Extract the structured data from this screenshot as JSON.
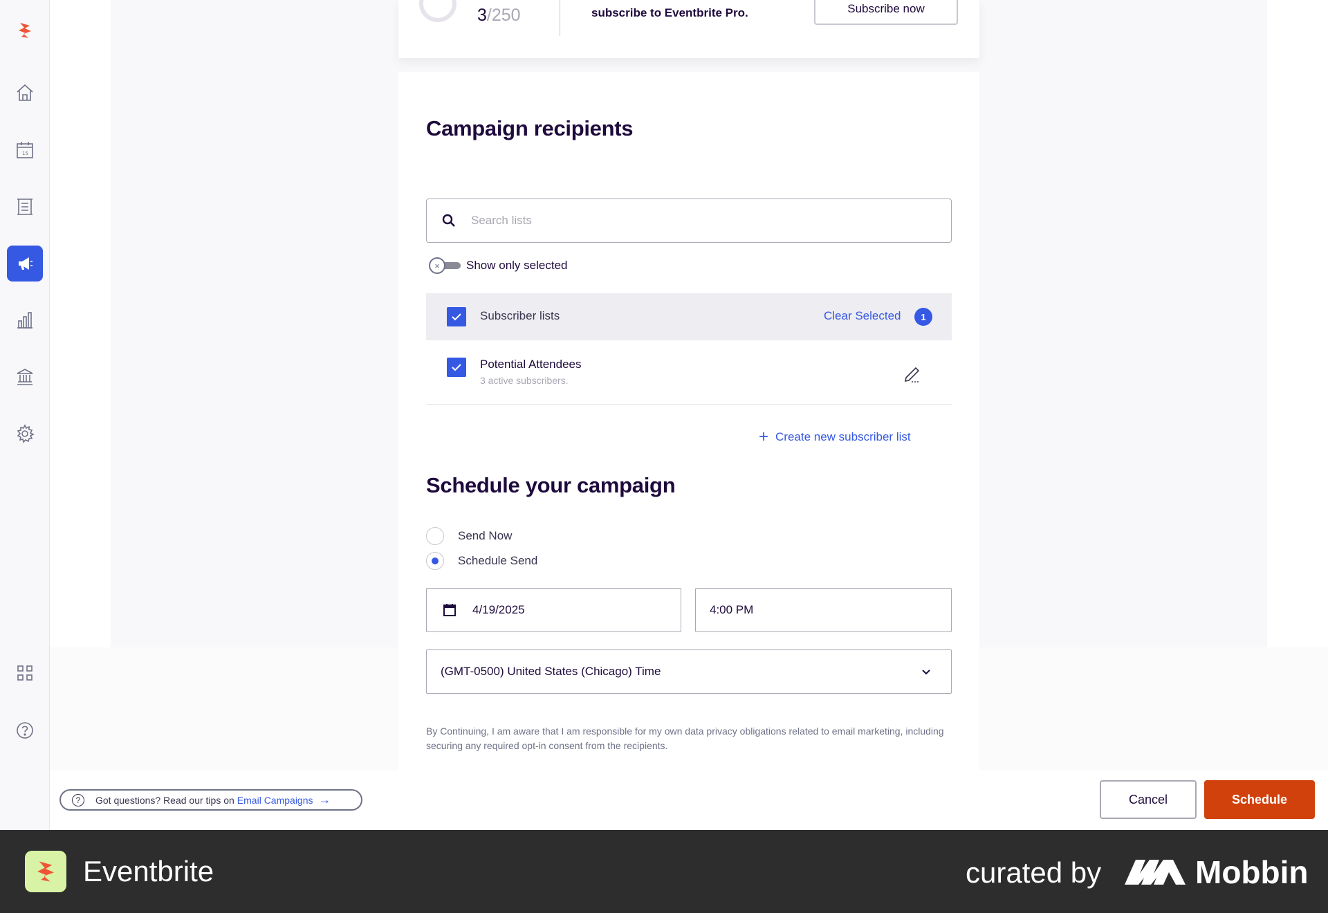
{
  "sidebar": {
    "items": [
      "home",
      "events",
      "orders",
      "marketing",
      "reporting",
      "finance",
      "settings",
      "apps",
      "help"
    ],
    "active": "marketing"
  },
  "limits": {
    "count": "3",
    "max": "/250",
    "upsell": "subscribe to Eventbrite Pro.",
    "subscribe_label": "Subscribe now"
  },
  "recipients": {
    "title": "Campaign recipients",
    "search_placeholder": "Search lists",
    "toggle_label": "Show only selected",
    "header_label": "Subscriber lists",
    "clear_label": "Clear Selected",
    "selected_count": "1",
    "lists": [
      {
        "name": "Potential Attendees",
        "subtitle": "3 active subscribers."
      }
    ],
    "create_label": "Create new subscriber list"
  },
  "schedule": {
    "title": "Schedule your campaign",
    "options": [
      {
        "label": "Send Now",
        "selected": false
      },
      {
        "label": "Schedule Send",
        "selected": true
      }
    ],
    "date": "4/19/2025",
    "time": "4:00 PM",
    "timezone": "(GMT-0500) United States (Chicago) Time",
    "disclaimer": "By Continuing, I am aware that I am responsible for my own data privacy obligations related to email marketing, including securing any required opt-in consent from the recipients."
  },
  "bottom": {
    "help_text": "Got questions? Read our tips on",
    "help_link": "Email Campaigns",
    "cancel_label": "Cancel",
    "schedule_label": "Schedule"
  },
  "footer": {
    "brand": "Eventbrite",
    "curated": "curated by",
    "mobbin": "Mobbin"
  },
  "colors": {
    "accent": "#3659e3",
    "primary_button": "#d1410c",
    "brand": "#f05537",
    "footer_bg": "#2d2d2d"
  }
}
